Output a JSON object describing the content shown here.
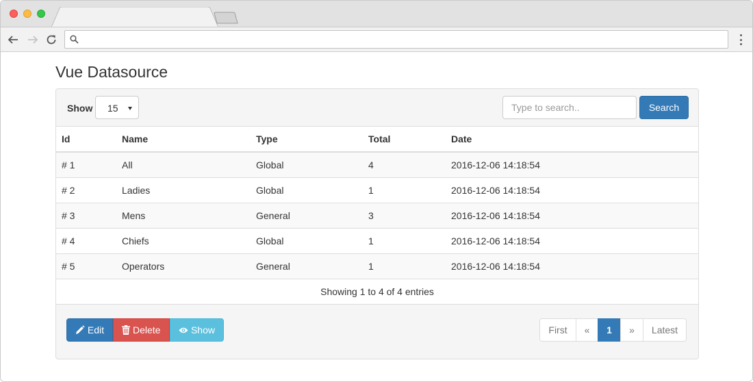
{
  "browser": {
    "address_value": "",
    "address_placeholder": ""
  },
  "page": {
    "title": "Vue Datasource"
  },
  "controls": {
    "show_label": "Show",
    "page_size": "15",
    "search_placeholder": "Type to search..",
    "search_button": "Search"
  },
  "table": {
    "columns": [
      "Id",
      "Name",
      "Type",
      "Total",
      "Date"
    ],
    "rows": [
      {
        "id": "# 1",
        "name": "All",
        "type": "Global",
        "total": "4",
        "date": "2016-12-06 14:18:54"
      },
      {
        "id": "# 2",
        "name": "Ladies",
        "type": "Global",
        "total": "1",
        "date": "2016-12-06 14:18:54"
      },
      {
        "id": "# 3",
        "name": "Mens",
        "type": "General",
        "total": "3",
        "date": "2016-12-06 14:18:54"
      },
      {
        "id": "# 4",
        "name": "Chiefs",
        "type": "Global",
        "total": "1",
        "date": "2016-12-06 14:18:54"
      },
      {
        "id": "# 5",
        "name": "Operators",
        "type": "General",
        "total": "1",
        "date": "2016-12-06 14:18:54"
      }
    ],
    "footer": "Showing 1 to 4 of 4 entries"
  },
  "actions": {
    "edit": "Edit",
    "delete": "Delete",
    "show": "Show"
  },
  "pagination": {
    "first": "First",
    "prev": "«",
    "current": "1",
    "next": "»",
    "last": "Latest"
  },
  "colors": {
    "primary": "#337ab7",
    "danger": "#d9534f",
    "info": "#5bc0de"
  },
  "icons": {
    "edit": "pencil-icon",
    "delete": "trash-icon",
    "show": "eye-icon"
  }
}
